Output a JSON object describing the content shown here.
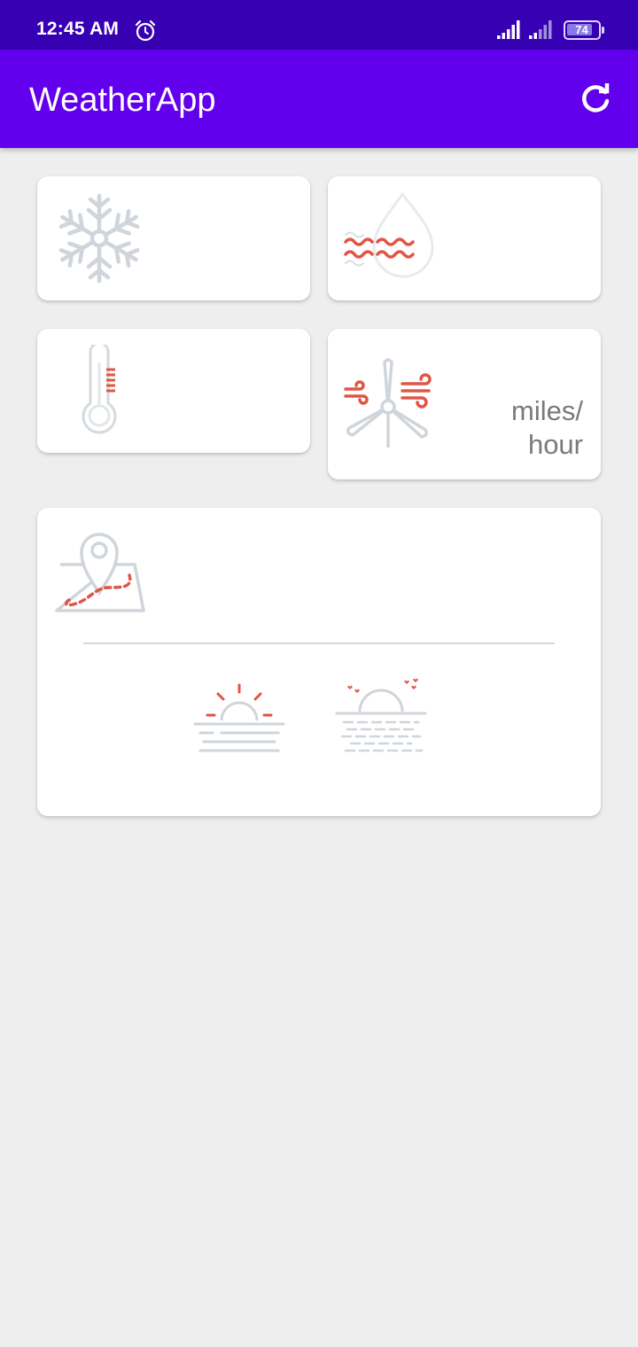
{
  "status_bar": {
    "time": "12:45 AM",
    "battery_level": "74",
    "icons": [
      "alarm-icon",
      "signal-icon",
      "signal-icon",
      "battery-icon"
    ]
  },
  "app_bar": {
    "title": "WeatherApp",
    "refresh_icon": "refresh-icon"
  },
  "cards": {
    "snow": {
      "icon": "snowflake-icon"
    },
    "humidity": {
      "icon": "humidity-drop-icon"
    },
    "temperature": {
      "icon": "thermometer-icon"
    },
    "wind": {
      "icon": "wind-turbine-icon",
      "unit": "miles/ hour"
    },
    "location": {
      "icon": "map-pin-icon",
      "sunrise_icon": "sunrise-icon",
      "sunset_icon": "sunset-icon"
    }
  },
  "colors": {
    "status_bar": "#3700b3",
    "app_bar": "#6200ee",
    "background": "#eeeeee",
    "icon_gray": "#cfd5da",
    "icon_red": "#e05545"
  }
}
